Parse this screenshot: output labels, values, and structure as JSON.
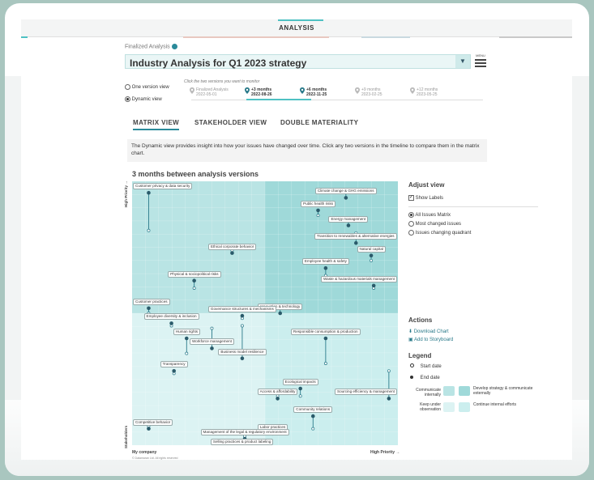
{
  "header": {
    "title": "ANALYSIS"
  },
  "analysis": {
    "status_label": "Finalized Analysis",
    "title": "Industry Analysis for Q1 2023 strategy",
    "menu_label": "MENU"
  },
  "view_modes": {
    "one_version": "One version view",
    "dynamic": "Dynamic view",
    "selected": "Dynamic view"
  },
  "timeline": {
    "hint": "Click the two versions you want to monitor",
    "items": [
      {
        "label": "Finalized Analysis",
        "date": "2022-05-01",
        "active": false
      },
      {
        "label": "+3 months",
        "date": "2022-08-26",
        "active": true
      },
      {
        "label": "+6 months",
        "date": "2022-11-25",
        "active": true
      },
      {
        "label": "+9 months",
        "date": "2023-02-25",
        "active": false
      },
      {
        "label": "+12 months",
        "date": "2023-05-25",
        "active": false
      }
    ]
  },
  "tabs": [
    {
      "label": "MATRIX VIEW",
      "active": true
    },
    {
      "label": "STAKEHOLDER VIEW",
      "active": false
    },
    {
      "label": "DOUBLE MATERIALITY",
      "active": false
    }
  ],
  "info_text": "The Dynamic view provides insight into how your issues have changed over time. Click any two versions in the timeline to compare them in the matrix chart.",
  "chart": {
    "title": "3 months between analysis versions",
    "y_axis_top": "High Priority →",
    "y_axis_bottom": "Stakeholders",
    "x_axis_left": "My company",
    "x_axis_right": "High Priority →",
    "copyright": "© Datamaran Ltd. All rights reserved"
  },
  "chart_data": {
    "type": "scatter",
    "x_axis": "My company",
    "y_axis": "Stakeholders",
    "range": [
      0,
      100
    ],
    "series": [
      {
        "name": "Start date"
      },
      {
        "name": "End date"
      }
    ],
    "issues": [
      {
        "label": "Customer privacy & data security",
        "start": [
          4,
          83
        ],
        "end": [
          4,
          98
        ]
      },
      {
        "label": "Climate change & GHG emissions",
        "start": [
          82,
          98
        ],
        "end": [
          82,
          96
        ]
      },
      {
        "label": "Public health risks",
        "start": [
          71,
          89
        ],
        "end": [
          71,
          91
        ]
      },
      {
        "label": "Energy management",
        "start": [
          83,
          87
        ],
        "end": [
          83,
          85
        ]
      },
      {
        "label": "Transition to renewables & alternative energies",
        "start": [
          86,
          82
        ],
        "end": [
          86,
          78
        ]
      },
      {
        "label": "Ethical corporate behavior",
        "start": [
          37,
          75
        ],
        "end": [
          37,
          74
        ]
      },
      {
        "label": "Natural capital",
        "start": [
          92,
          71
        ],
        "end": [
          92,
          73
        ]
      },
      {
        "label": "Employee health & safety",
        "start": [
          74,
          65
        ],
        "end": [
          74,
          68
        ]
      },
      {
        "label": "Physical & sociopolitical risks",
        "start": [
          22,
          60
        ],
        "end": [
          22,
          63
        ]
      },
      {
        "label": "Waste & hazardous materials management",
        "start": [
          93,
          60
        ],
        "end": [
          93,
          61
        ]
      },
      {
        "label": "Innovation & technology",
        "start": [
          56,
          52
        ],
        "end": [
          56,
          50
        ]
      },
      {
        "label": "Customer practices",
        "start": [
          4,
          50
        ],
        "end": [
          4,
          52
        ]
      },
      {
        "label": "Governance structures & mechanisms",
        "start": [
          41,
          48
        ],
        "end": [
          41,
          49
        ]
      },
      {
        "label": "Employee diversity & inclusion",
        "start": [
          13,
          45
        ],
        "end": [
          13,
          46
        ]
      },
      {
        "label": "Human rights",
        "start": [
          19,
          34
        ],
        "end": [
          19,
          40
        ]
      },
      {
        "label": "Workforce management",
        "start": [
          29,
          44
        ],
        "end": [
          29,
          36
        ]
      },
      {
        "label": "Business model resilience",
        "start": [
          41,
          45
        ],
        "end": [
          41,
          32
        ]
      },
      {
        "label": "Responsible consumption & production",
        "start": [
          74,
          30
        ],
        "end": [
          74,
          40
        ]
      },
      {
        "label": "Transparency",
        "start": [
          14,
          26
        ],
        "end": [
          14,
          27
        ]
      },
      {
        "label": "Sourcing efficiency & management",
        "start": [
          99,
          27
        ],
        "end": [
          99,
          16
        ]
      },
      {
        "label": "Ecological impacts",
        "start": [
          64,
          17
        ],
        "end": [
          64,
          20
        ]
      },
      {
        "label": "Access & affordability",
        "start": [
          55,
          17
        ],
        "end": [
          55,
          16
        ]
      },
      {
        "label": "Competitive behavior",
        "start": [
          4,
          5
        ],
        "end": [
          4,
          4
        ]
      },
      {
        "label": "Community relations",
        "start": [
          69,
          4
        ],
        "end": [
          69,
          9
        ]
      },
      {
        "label": "Labor practices",
        "start": [
          53,
          3
        ],
        "end": [
          53,
          2
        ]
      },
      {
        "label": "Management of the legal & regulatory environment",
        "start": [
          42,
          1
        ],
        "end": [
          42,
          0
        ]
      },
      {
        "label": "Selling practices & product labeling",
        "start": [
          41,
          -4
        ],
        "end": [
          41,
          -5
        ]
      }
    ]
  },
  "adjust_view": {
    "title": "Adjust view",
    "show_labels": "Show Labels",
    "options": [
      "All Issues Matrix",
      "Most changed issues",
      "Issues changing quadrant"
    ],
    "selected": "All Issues Matrix"
  },
  "actions": {
    "title": "Actions",
    "download": "Download Chart",
    "storyboard": "Add to Storyboard"
  },
  "legend": {
    "title": "Legend",
    "start": "Start date",
    "end": "End date",
    "communicate": "Communicate internally",
    "develop": "Develop strategy & communicate externally",
    "keep": "Keep under observation",
    "continue": "Continue internal efforts"
  },
  "colors": {
    "accent": "#2a8a9a",
    "teal_light": "#4fc1c3",
    "quad_top_right": "#9fd9d9",
    "quad_top_left": "#b9e4e4",
    "quad_bottom_right": "#cbeeee",
    "quad_bottom_left": "#dcf3f3"
  }
}
